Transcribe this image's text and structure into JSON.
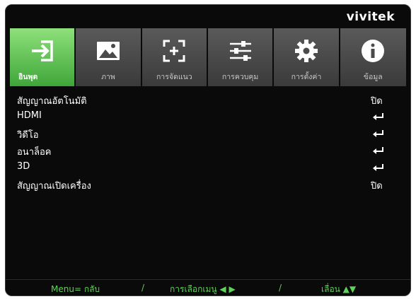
{
  "brand": "vivitek",
  "tabs": [
    {
      "label": "อินพุต",
      "icon": "input-icon",
      "active": true
    },
    {
      "label": "ภาพ",
      "icon": "image-icon",
      "active": false
    },
    {
      "label": "การจัดแนว",
      "icon": "alignment-icon",
      "active": false
    },
    {
      "label": "การควบคุม",
      "icon": "sliders-icon",
      "active": false
    },
    {
      "label": "การตั้งค่า",
      "icon": "gear-icon",
      "active": false
    },
    {
      "label": "ข้อมูล",
      "icon": "info-icon",
      "active": false
    }
  ],
  "menu": [
    {
      "label": "สัญญาณอัตโนมัติ",
      "value": "ปิด"
    },
    {
      "label": "HDMI",
      "value": "enter-icon"
    },
    {
      "label": "วิดีโอ",
      "value": "enter-icon"
    },
    {
      "label": "อนาล็อค",
      "value": "enter-icon"
    },
    {
      "label": "3D",
      "value": "enter-icon"
    },
    {
      "label": "สัญญาณเปิดเครื่อง",
      "value": "ปิด"
    }
  ],
  "footer": {
    "back": "Menu= กลับ",
    "sep1": "/",
    "select": "การเลือกเมนู ◀ ▶",
    "sep2": "/",
    "scroll": "เลื่อน ▲▼"
  },
  "colors": {
    "active_tab": "#4db846",
    "footer_text": "#5fd25a",
    "background": "#0a0a0a"
  }
}
